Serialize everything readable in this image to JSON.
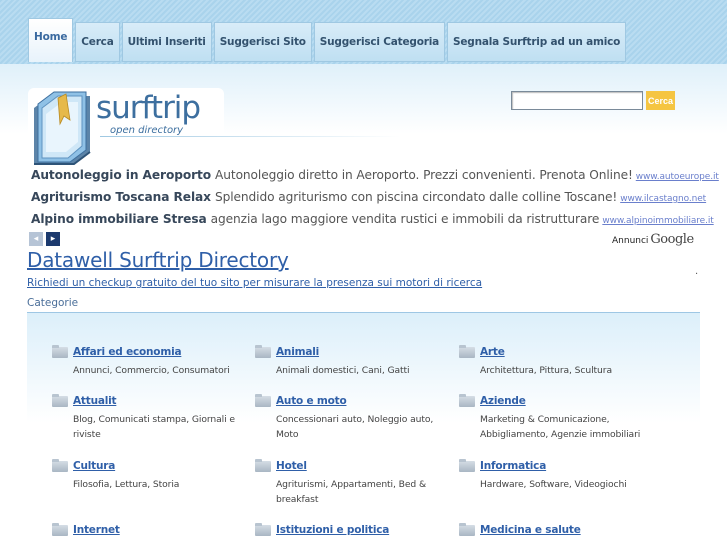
{
  "nav": {
    "tabs": [
      {
        "label": "Home",
        "active": true
      },
      {
        "label": "Cerca"
      },
      {
        "label": "Ultimi Inseriti"
      },
      {
        "label": "Suggerisci Sito"
      },
      {
        "label": "Suggerisci Categoria"
      },
      {
        "label": "Segnala Surftrip ad un amico"
      }
    ]
  },
  "logo": {
    "name": "surftrip",
    "subtitle": "open directory"
  },
  "search": {
    "value": "",
    "button_label": "Cerca"
  },
  "ads": [
    {
      "title": "Autonoleggio in Aeroporto",
      "text": "Autonoleggio diretto in Aeroporto. Prezzi convenienti. Prenota Online!",
      "url": "www.autoeurope.it"
    },
    {
      "title": "Agriturismo Toscana Relax",
      "text": "Splendido agriturismo con piscina circondato dalle colline Toscane!",
      "url": "www.ilcastagno.net"
    },
    {
      "title": "Alpino immobiliare Stresa",
      "text": "agenzia lago maggiore vendita rustici e immobili da ristrutturare",
      "url": "www.alpinoimmobiliare.it"
    }
  ],
  "ads_footer": {
    "prev": "◂",
    "next": "▸",
    "label": "Annunci",
    "brand": "Google"
  },
  "directory": {
    "title": "Datawell Surftrip Directory",
    "link": "Richiedi un checkup gratuito del tuo sito per misurare la presenza sui motori di ricerca",
    "dot": ".",
    "categories_label": "Categorie"
  },
  "categories": [
    {
      "name": "Affari ed economia",
      "desc": "Annunci, Commercio, Consumatori"
    },
    {
      "name": "Animali",
      "desc": "Animali domestici, Cani, Gatti"
    },
    {
      "name": "Arte",
      "desc": "Architettura, Pittura, Scultura"
    },
    {
      "name": "Attualit",
      "desc": "Blog, Comunicati stampa, Giornali e riviste"
    },
    {
      "name": "Auto e moto",
      "desc": "Concessionari auto, Noleggio auto, Moto"
    },
    {
      "name": "Aziende",
      "desc": "Marketing & Comunicazione, Abbigliamento, Agenzie immobiliari"
    },
    {
      "name": "Cultura",
      "desc": "Filosofia, Lettura, Storia"
    },
    {
      "name": "Hotel",
      "desc": "Agriturismi, Appartamenti, Bed & breakfast"
    },
    {
      "name": "Informatica",
      "desc": "Hardware, Software, Videogiochi"
    },
    {
      "name": "Internet",
      "desc": ""
    },
    {
      "name": "Istituzioni e politica",
      "desc": ""
    },
    {
      "name": "Medicina e salute",
      "desc": ""
    }
  ]
}
